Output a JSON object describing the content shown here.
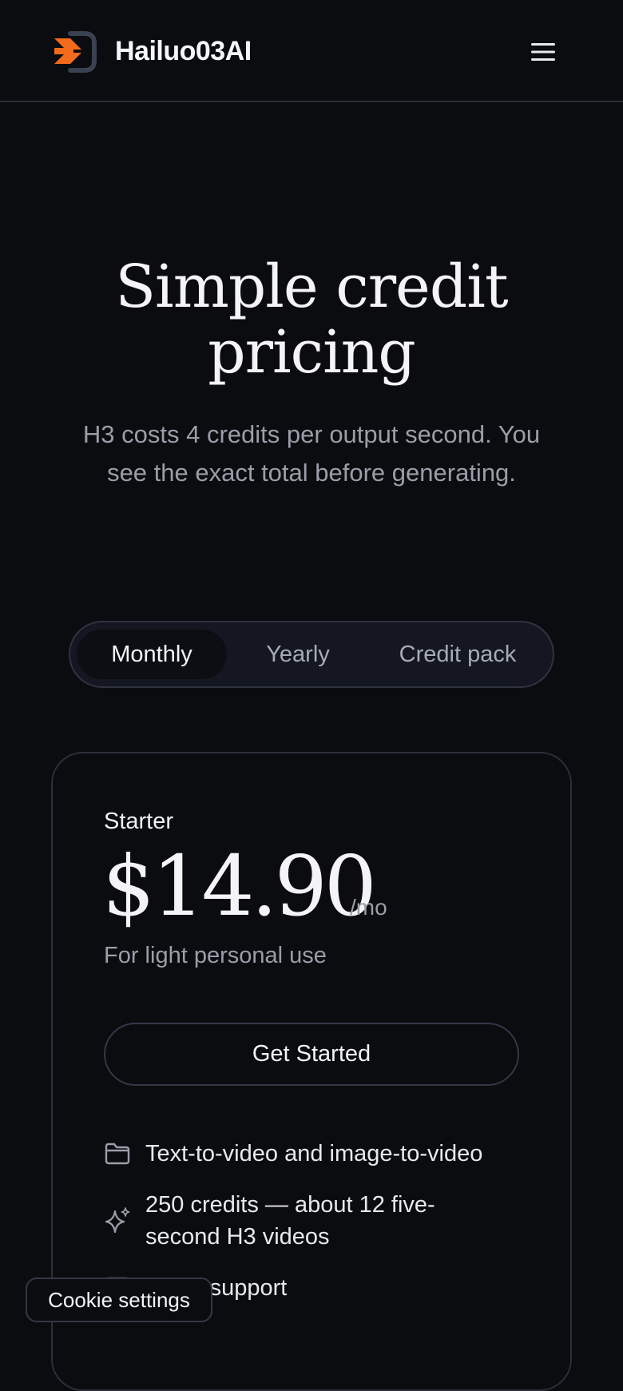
{
  "header": {
    "brand": "Hailuo03AI",
    "logo_icon": "chevron-arrow-logo-icon",
    "menu_icon": "hamburger-menu-icon"
  },
  "hero": {
    "title_line1": "Simple credit",
    "title_line2": "pricing",
    "subtitle_line1": "H3 costs 4 credits per output second. You",
    "subtitle_line2": "see the exact total before generating."
  },
  "billing_toggle": {
    "options": [
      "Monthly",
      "Yearly",
      "Credit pack"
    ],
    "selected": "Monthly"
  },
  "plan": {
    "name": "Starter",
    "price": "$14.90",
    "period": "/mo",
    "description": "For light personal use",
    "cta_label": "Get Started",
    "features": [
      {
        "icon": "folder-icon",
        "line1": "Text-to-video and image-to-video",
        "line2": ""
      },
      {
        "icon": "sparkle-icon",
        "line1": "250 credits — about 12 five-",
        "line2": "second H3 videos"
      },
      {
        "icon": "mail-icon",
        "line1": "Email support",
        "line2": ""
      }
    ]
  },
  "cookie_button": {
    "label": "Cookie settings"
  },
  "colors": {
    "background": "#0b0c10",
    "accent_orange": "#f26a1b",
    "muted_text": "#9a9ea8",
    "border": "#2f3340"
  }
}
